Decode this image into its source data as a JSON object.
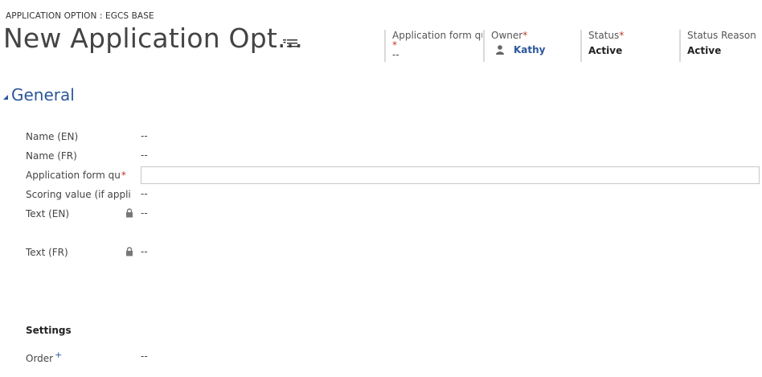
{
  "header": {
    "entity_label": "APPLICATION OPTION : EGCS BASE",
    "record_title": "New Application Opt...",
    "fields": [
      {
        "label": "Application form qu",
        "value": "--"
      },
      {
        "label": "Owner",
        "value": "Kathy"
      },
      {
        "label": "Status",
        "value": "Active"
      },
      {
        "label": "Status Reason",
        "value": "Active"
      }
    ],
    "required_marker": "*"
  },
  "section": {
    "title": "General"
  },
  "form": {
    "fields": [
      {
        "label": "Name (EN)",
        "value": "--"
      },
      {
        "label": "Name (FR)",
        "value": "--"
      },
      {
        "label": "Application form qu",
        "value": ""
      },
      {
        "label": "Scoring value (if appli",
        "value": "--"
      },
      {
        "label": "Text (EN)",
        "value": "--"
      },
      {
        "label": "Text (FR)",
        "value": "--"
      }
    ],
    "settings_title": "Settings",
    "order_label": "Order",
    "order_marker": "+",
    "order_value": "--"
  },
  "colors": {
    "accent": "#2b579a",
    "required": "#c0392b"
  }
}
